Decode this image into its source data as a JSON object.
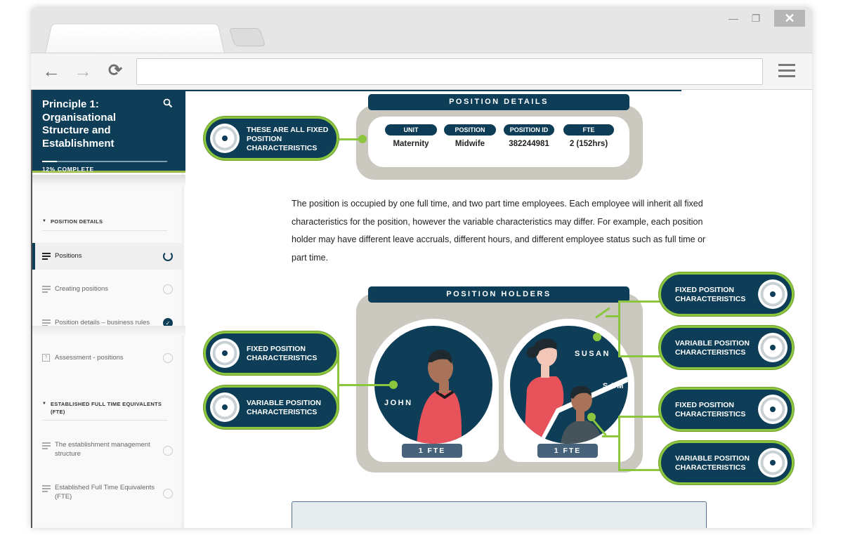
{
  "browser": {
    "window_controls": {
      "minimize": "—",
      "maximize": "❐",
      "close": "✕"
    },
    "nav": {
      "back": "←",
      "forward": "→",
      "reload": "⟳"
    },
    "url": ""
  },
  "sidebar": {
    "course_title": "Principle 1: Organisational Structure and Establishment",
    "search_icon": "⌕",
    "progress_percent": 12,
    "progress_label": "12% COMPLETE",
    "sections": [
      {
        "title": "POSITION DETAILS",
        "items": [
          {
            "label": "Positions",
            "type": "lesson",
            "status": "in-progress",
            "active": true
          },
          {
            "label": "Creating positions",
            "type": "lesson",
            "status": "not-started"
          },
          {
            "label": "Position details – business rules",
            "type": "lesson",
            "status": "complete",
            "status_glyph": "✓"
          },
          {
            "label": "Assessment - positions",
            "type": "quiz",
            "status": "not-started",
            "quiz_glyph": "?"
          }
        ]
      },
      {
        "title": "ESTABLISHED FULL TIME EQUIVALENTS (FTE)",
        "items": [
          {
            "label": "The establishment management structure",
            "type": "lesson",
            "status": "not-started"
          },
          {
            "label": "Established Full Time Equivalents (FTE)",
            "type": "lesson",
            "status": "not-started"
          }
        ]
      }
    ]
  },
  "main": {
    "position_details": {
      "title": "POSITION DETAILS",
      "callout": "THESE ARE ALL FIXED POSITION CHARACTERISTICS",
      "fields": [
        {
          "label": "UNIT",
          "value": "Maternity"
        },
        {
          "label": "POSITION",
          "value": "Midwife"
        },
        {
          "label": "POSITION ID",
          "value": "382244981"
        },
        {
          "label": "FTE",
          "value": "2 (152hrs)"
        }
      ]
    },
    "paragraph": "The position is occupied by one full time, and two part time employees. Each employee will inherit all fixed characteristics for the position, however the variable characteristics may differ. For example, each position holder may have different leave accruals, different hours, and different employee status such as full time or part time.",
    "position_holders": {
      "title": "POSITION HOLDERS",
      "holders": [
        {
          "names": [
            "JOHN"
          ],
          "fte": "1 FTE"
        },
        {
          "names": [
            "SUSAN",
            "SAM"
          ],
          "fte": "1 FTE"
        }
      ],
      "labels": {
        "fixed": "FIXED POSITION CHARACTERISTICS",
        "variable": "VARIABLE POSITION CHARACTERISTICS"
      }
    },
    "colors": {
      "navy": "#0d3d57",
      "green": "#8cc63f",
      "gray_panel": "#cbc8bf",
      "fte_badge": "#46637b",
      "shirt_red": "#e8525a"
    }
  }
}
